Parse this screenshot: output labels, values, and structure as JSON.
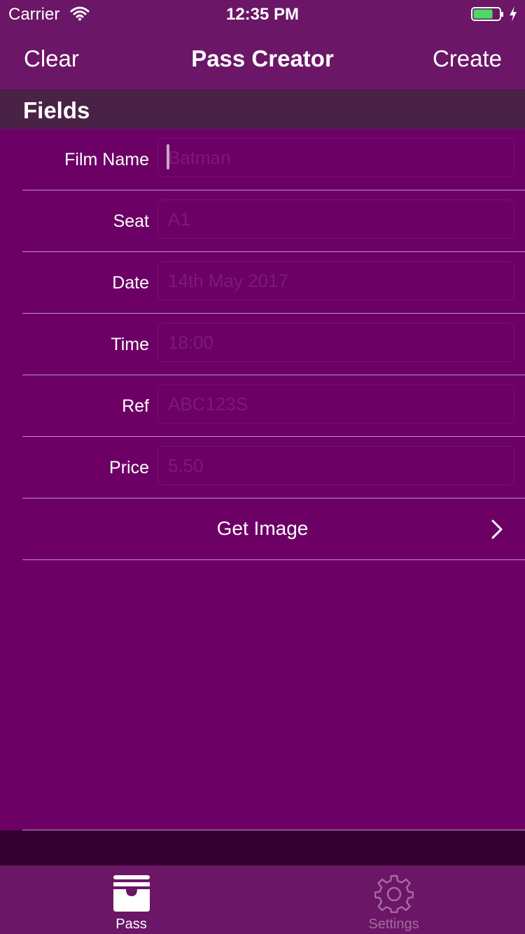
{
  "status_bar": {
    "carrier": "Carrier",
    "time": "12:35 PM",
    "battery_level": 0.75,
    "battery_color": "#4cd964"
  },
  "nav": {
    "left_button": "Clear",
    "title": "Pass Creator",
    "right_button": "Create"
  },
  "section": {
    "title": "Fields"
  },
  "fields": [
    {
      "label": "Film Name",
      "placeholder": "Batman",
      "value": ""
    },
    {
      "label": "Seat",
      "placeholder": "A1",
      "value": ""
    },
    {
      "label": "Date",
      "placeholder": "14th May 2017",
      "value": ""
    },
    {
      "label": "Time",
      "placeholder": "18:00",
      "value": ""
    },
    {
      "label": "Ref",
      "placeholder": "ABC123S",
      "value": ""
    },
    {
      "label": "Price",
      "placeholder": "5.50",
      "value": ""
    }
  ],
  "get_image": {
    "label": "Get Image",
    "icon": "chevron-right-icon"
  },
  "tabs": [
    {
      "label": "Pass",
      "icon": "pass-tray-icon",
      "selected": true
    },
    {
      "label": "Settings",
      "icon": "gear-icon",
      "selected": false
    }
  ],
  "colors": {
    "background": "#6c0065",
    "bar": "#6b1666",
    "section_header": "#4a2246",
    "separator": "#c88bc4",
    "inactive_tab": "#a868a3"
  }
}
